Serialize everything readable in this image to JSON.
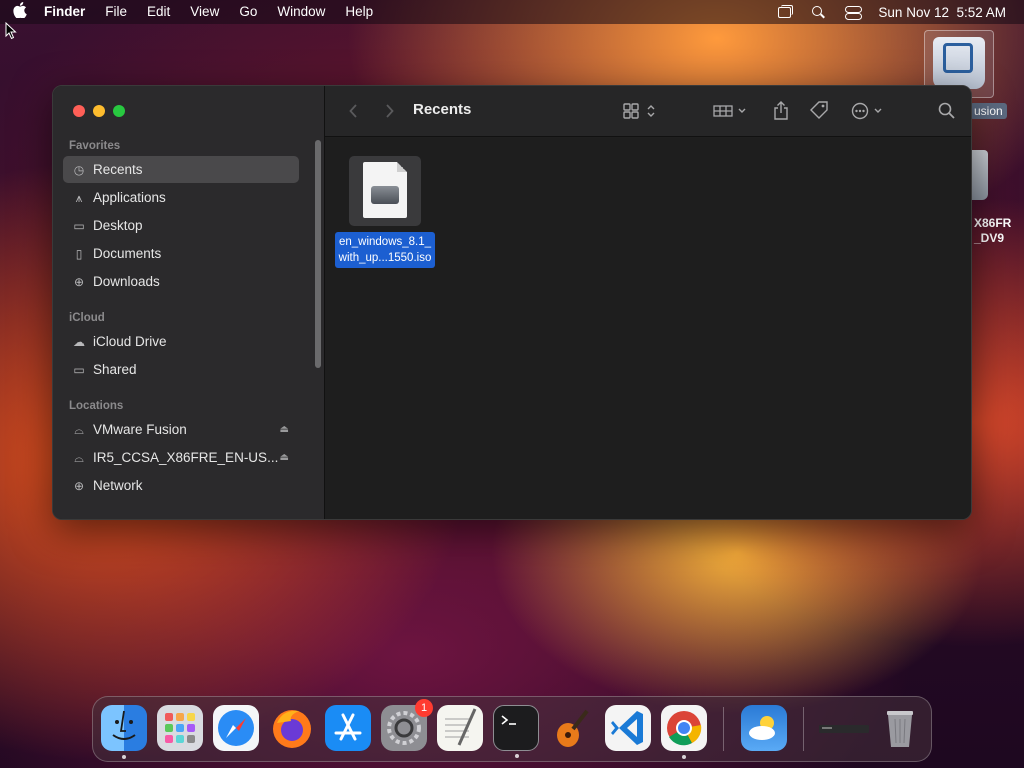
{
  "menubar": {
    "apple_icon": "apple-icon",
    "app_name": "Finder",
    "menus": [
      "File",
      "Edit",
      "View",
      "Go",
      "Window",
      "Help"
    ],
    "datetime": "Sun Nov 12  5:52 AM"
  },
  "desktop": {
    "vmware_label": "usion",
    "iso_label_line1": "X86FR",
    "iso_label_line2": "_DV9"
  },
  "finder": {
    "title": "Recents",
    "sections": {
      "favorites": "Favorites",
      "icloud": "iCloud",
      "locations": "Locations"
    },
    "favorites": [
      "Recents",
      "Applications",
      "Desktop",
      "Documents",
      "Downloads"
    ],
    "icloud": [
      "iCloud Drive",
      "Shared"
    ],
    "locations": [
      "VMware Fusion",
      "IR5_CCSA_X86FRE_EN-US...",
      "Network"
    ],
    "file": {
      "name_line1": "en_windows_8.1_",
      "name_line2": "with_up...1550.iso"
    }
  },
  "dock": {
    "settings_badge": "1",
    "apps": [
      "Finder",
      "Launchpad",
      "Safari",
      "Firefox",
      "App Store",
      "System Settings",
      "TextEdit",
      "Terminal",
      "GarageBand",
      "Visual Studio Code",
      "Google Chrome",
      "Weather",
      "Trash"
    ]
  },
  "colors": {
    "selection": "#1c5fd1",
    "close": "#ff5f57",
    "minimize": "#febc2e",
    "zoom": "#28c840"
  }
}
